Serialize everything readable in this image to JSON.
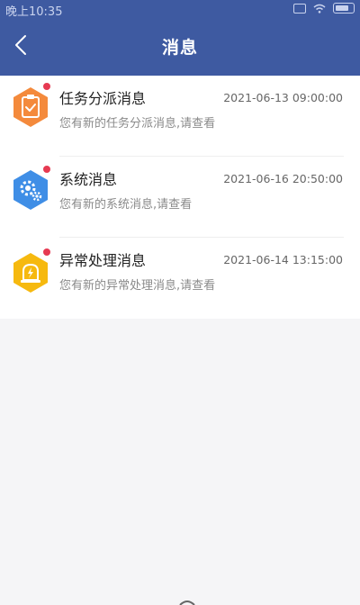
{
  "status_bar": {
    "time": "晚上10:35"
  },
  "header": {
    "title": "消息"
  },
  "messages": [
    {
      "title": "任务分派消息",
      "time": "2021-06-13 09:00:00",
      "subtitle": "您有新的任务分派消息,请查看",
      "icon": "clipboard-check-icon",
      "color": "#f48a3c",
      "unread": true
    },
    {
      "title": "系统消息",
      "time": "2021-06-16 20:50:00",
      "subtitle": "您有新的系统消息,请查看",
      "icon": "gears-icon",
      "color": "#3f8ee6",
      "unread": true
    },
    {
      "title": "异常处理消息",
      "time": "2021-06-14 13:15:00",
      "subtitle": "您有新的异常处理消息,请查看",
      "icon": "alert-bolt-icon",
      "color": "#f6b90f",
      "unread": true
    }
  ],
  "colors": {
    "header_bg": "#3e5aa1",
    "unread_dot": "#e63a52",
    "page_bg": "#f5f5f7"
  }
}
